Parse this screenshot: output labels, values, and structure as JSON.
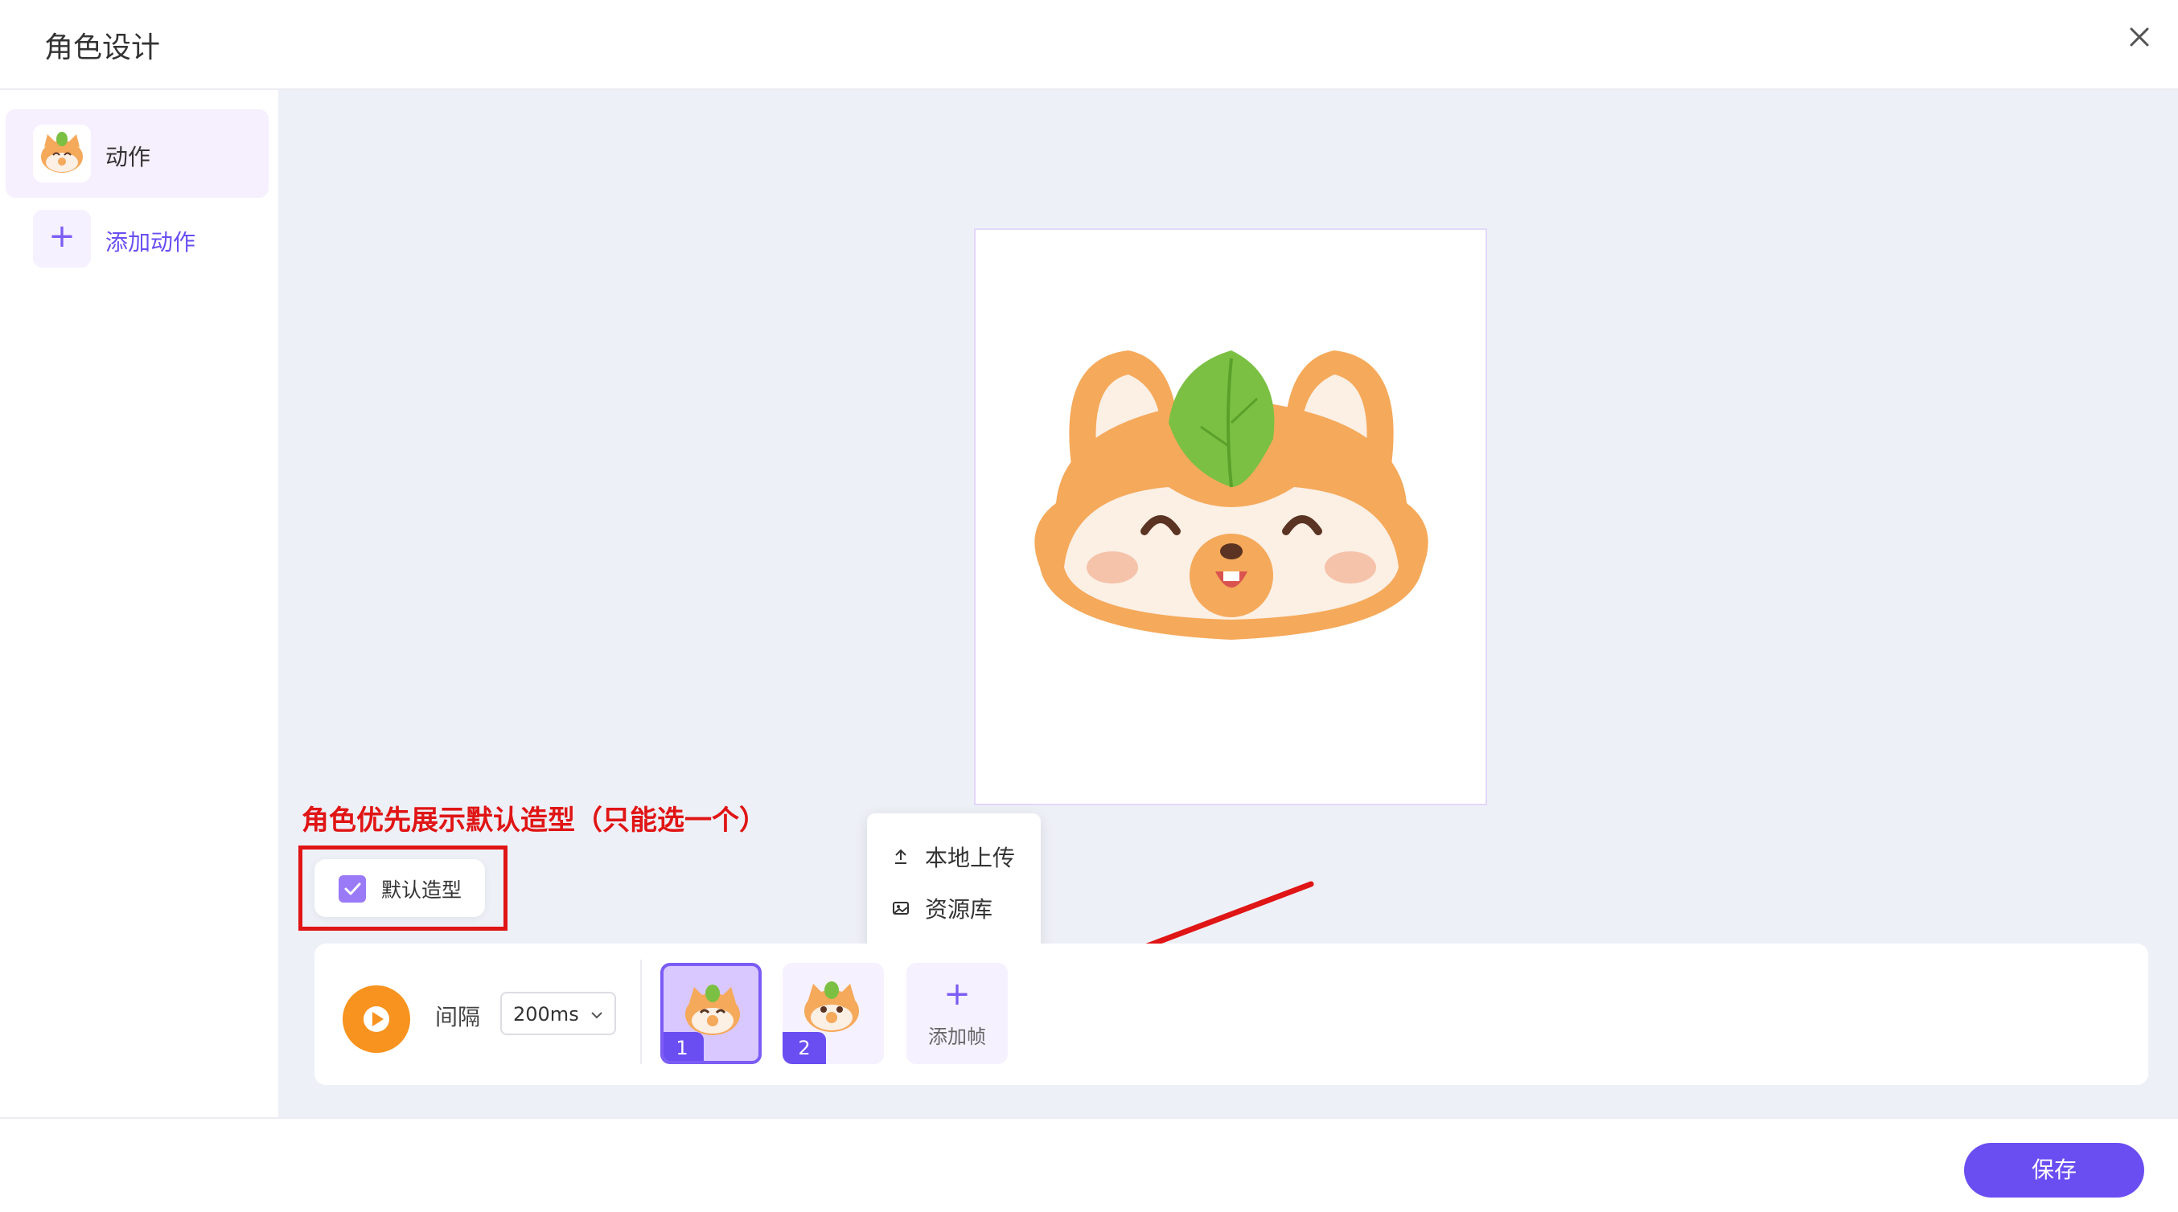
{
  "header": {
    "title": "角色设计",
    "close_icon": "close-icon"
  },
  "sidebar": {
    "items": [
      {
        "label": "动作",
        "active": true
      },
      {
        "label": "添加动作",
        "icon": "plus-icon"
      }
    ]
  },
  "annotation": {
    "text": "角色优先展示默认造型（只能选一个）",
    "color": "#e01515"
  },
  "default_shape": {
    "label": "默认造型",
    "checked": true
  },
  "add_frame_menu": {
    "items": [
      {
        "label": "本地上传",
        "icon": "upload-icon"
      },
      {
        "label": "资源库",
        "icon": "image-icon"
      }
    ]
  },
  "timeline": {
    "interval_label": "间隔",
    "interval_value": "200ms",
    "frames": [
      {
        "number": "1",
        "selected": true
      },
      {
        "number": "2",
        "selected": false
      }
    ],
    "add_frame_label": "添加帧"
  },
  "footer": {
    "save_label": "保存"
  },
  "colors": {
    "accent": "#6a4ef2",
    "play": "#f7931e",
    "annotation": "#e01515"
  }
}
